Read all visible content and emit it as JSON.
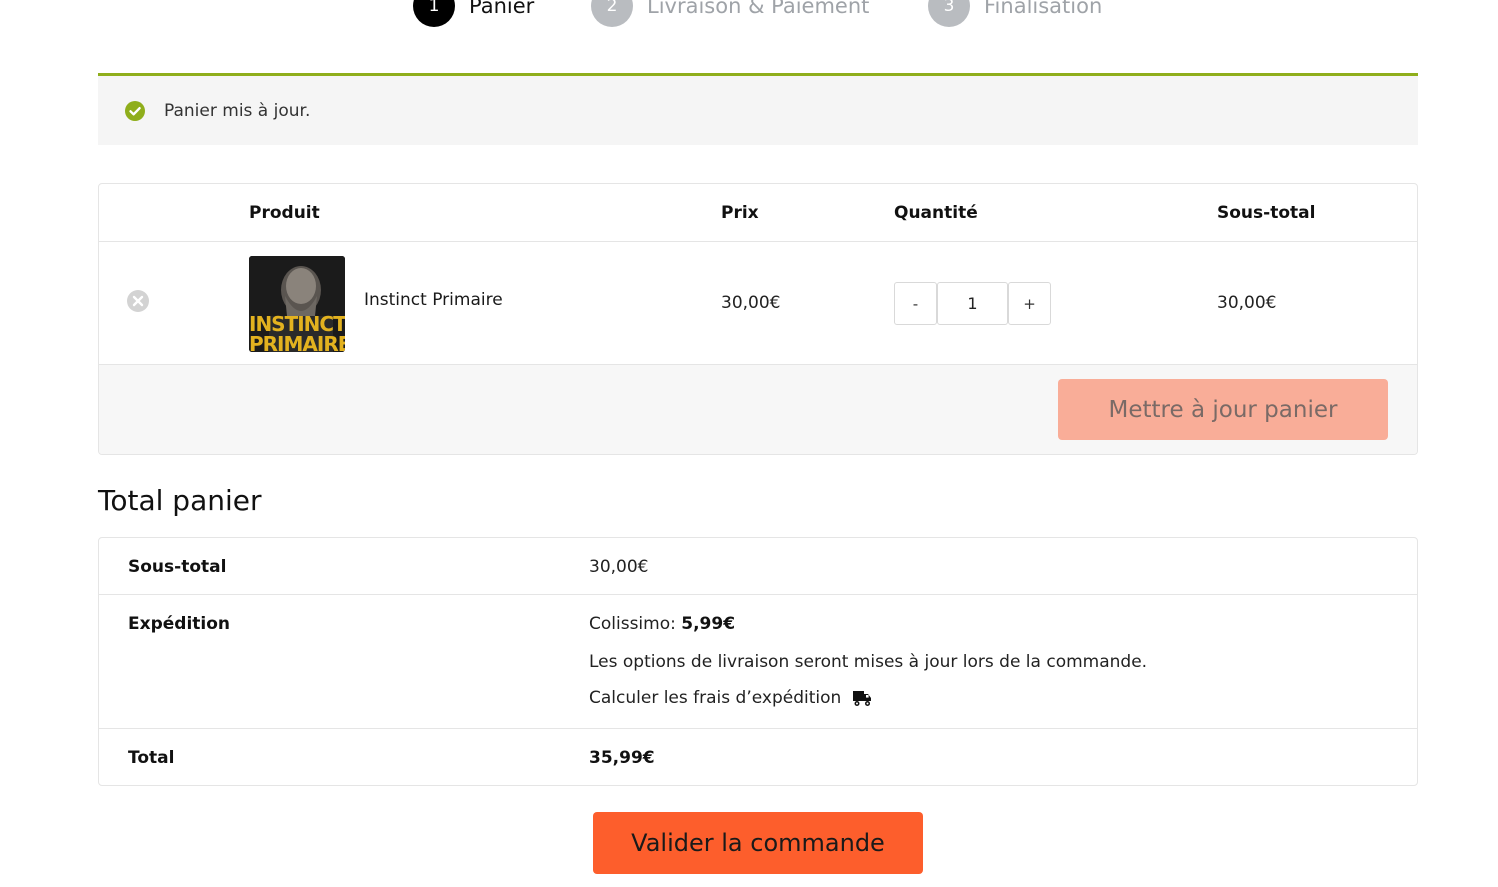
{
  "steps": [
    {
      "number": "1",
      "label": "Panier",
      "state": "active"
    },
    {
      "number": "2",
      "label": "Livraison & Paiement",
      "state": "inactive"
    },
    {
      "number": "3",
      "label": "Finalisation",
      "state": "inactive"
    }
  ],
  "notice": {
    "icon": "check-circle-icon",
    "text": "Panier mis à jour."
  },
  "cart": {
    "headers": {
      "product": "Produit",
      "price": "Prix",
      "quantity": "Quantité",
      "subtotal": "Sous-total"
    },
    "items": [
      {
        "thumbnail_text": "INSTINCT PRIMAIRE",
        "name": "Instinct Primaire",
        "price": "30,00€",
        "quantity": "1",
        "subtotal": "30,00€"
      }
    ],
    "qty_minus": "-",
    "qty_plus": "+",
    "update_button": "Mettre à jour panier"
  },
  "totals": {
    "title": "Total panier",
    "subtotal_label": "Sous-total",
    "subtotal_value": "30,00€",
    "shipping_label": "Expédition",
    "shipping_method": "Colissimo:",
    "shipping_price": "5,99€",
    "shipping_note": "Les options de livraison seront mises à jour lors de la commande.",
    "calc_shipping": "Calculer les frais d’expédition",
    "total_label": "Total",
    "total_value": "35,99€"
  },
  "checkout_button": "Valider la commande",
  "colors": {
    "accent_green": "#8fae1b",
    "update_button": "#f9ad98",
    "checkout_button": "#fd5e2c"
  }
}
